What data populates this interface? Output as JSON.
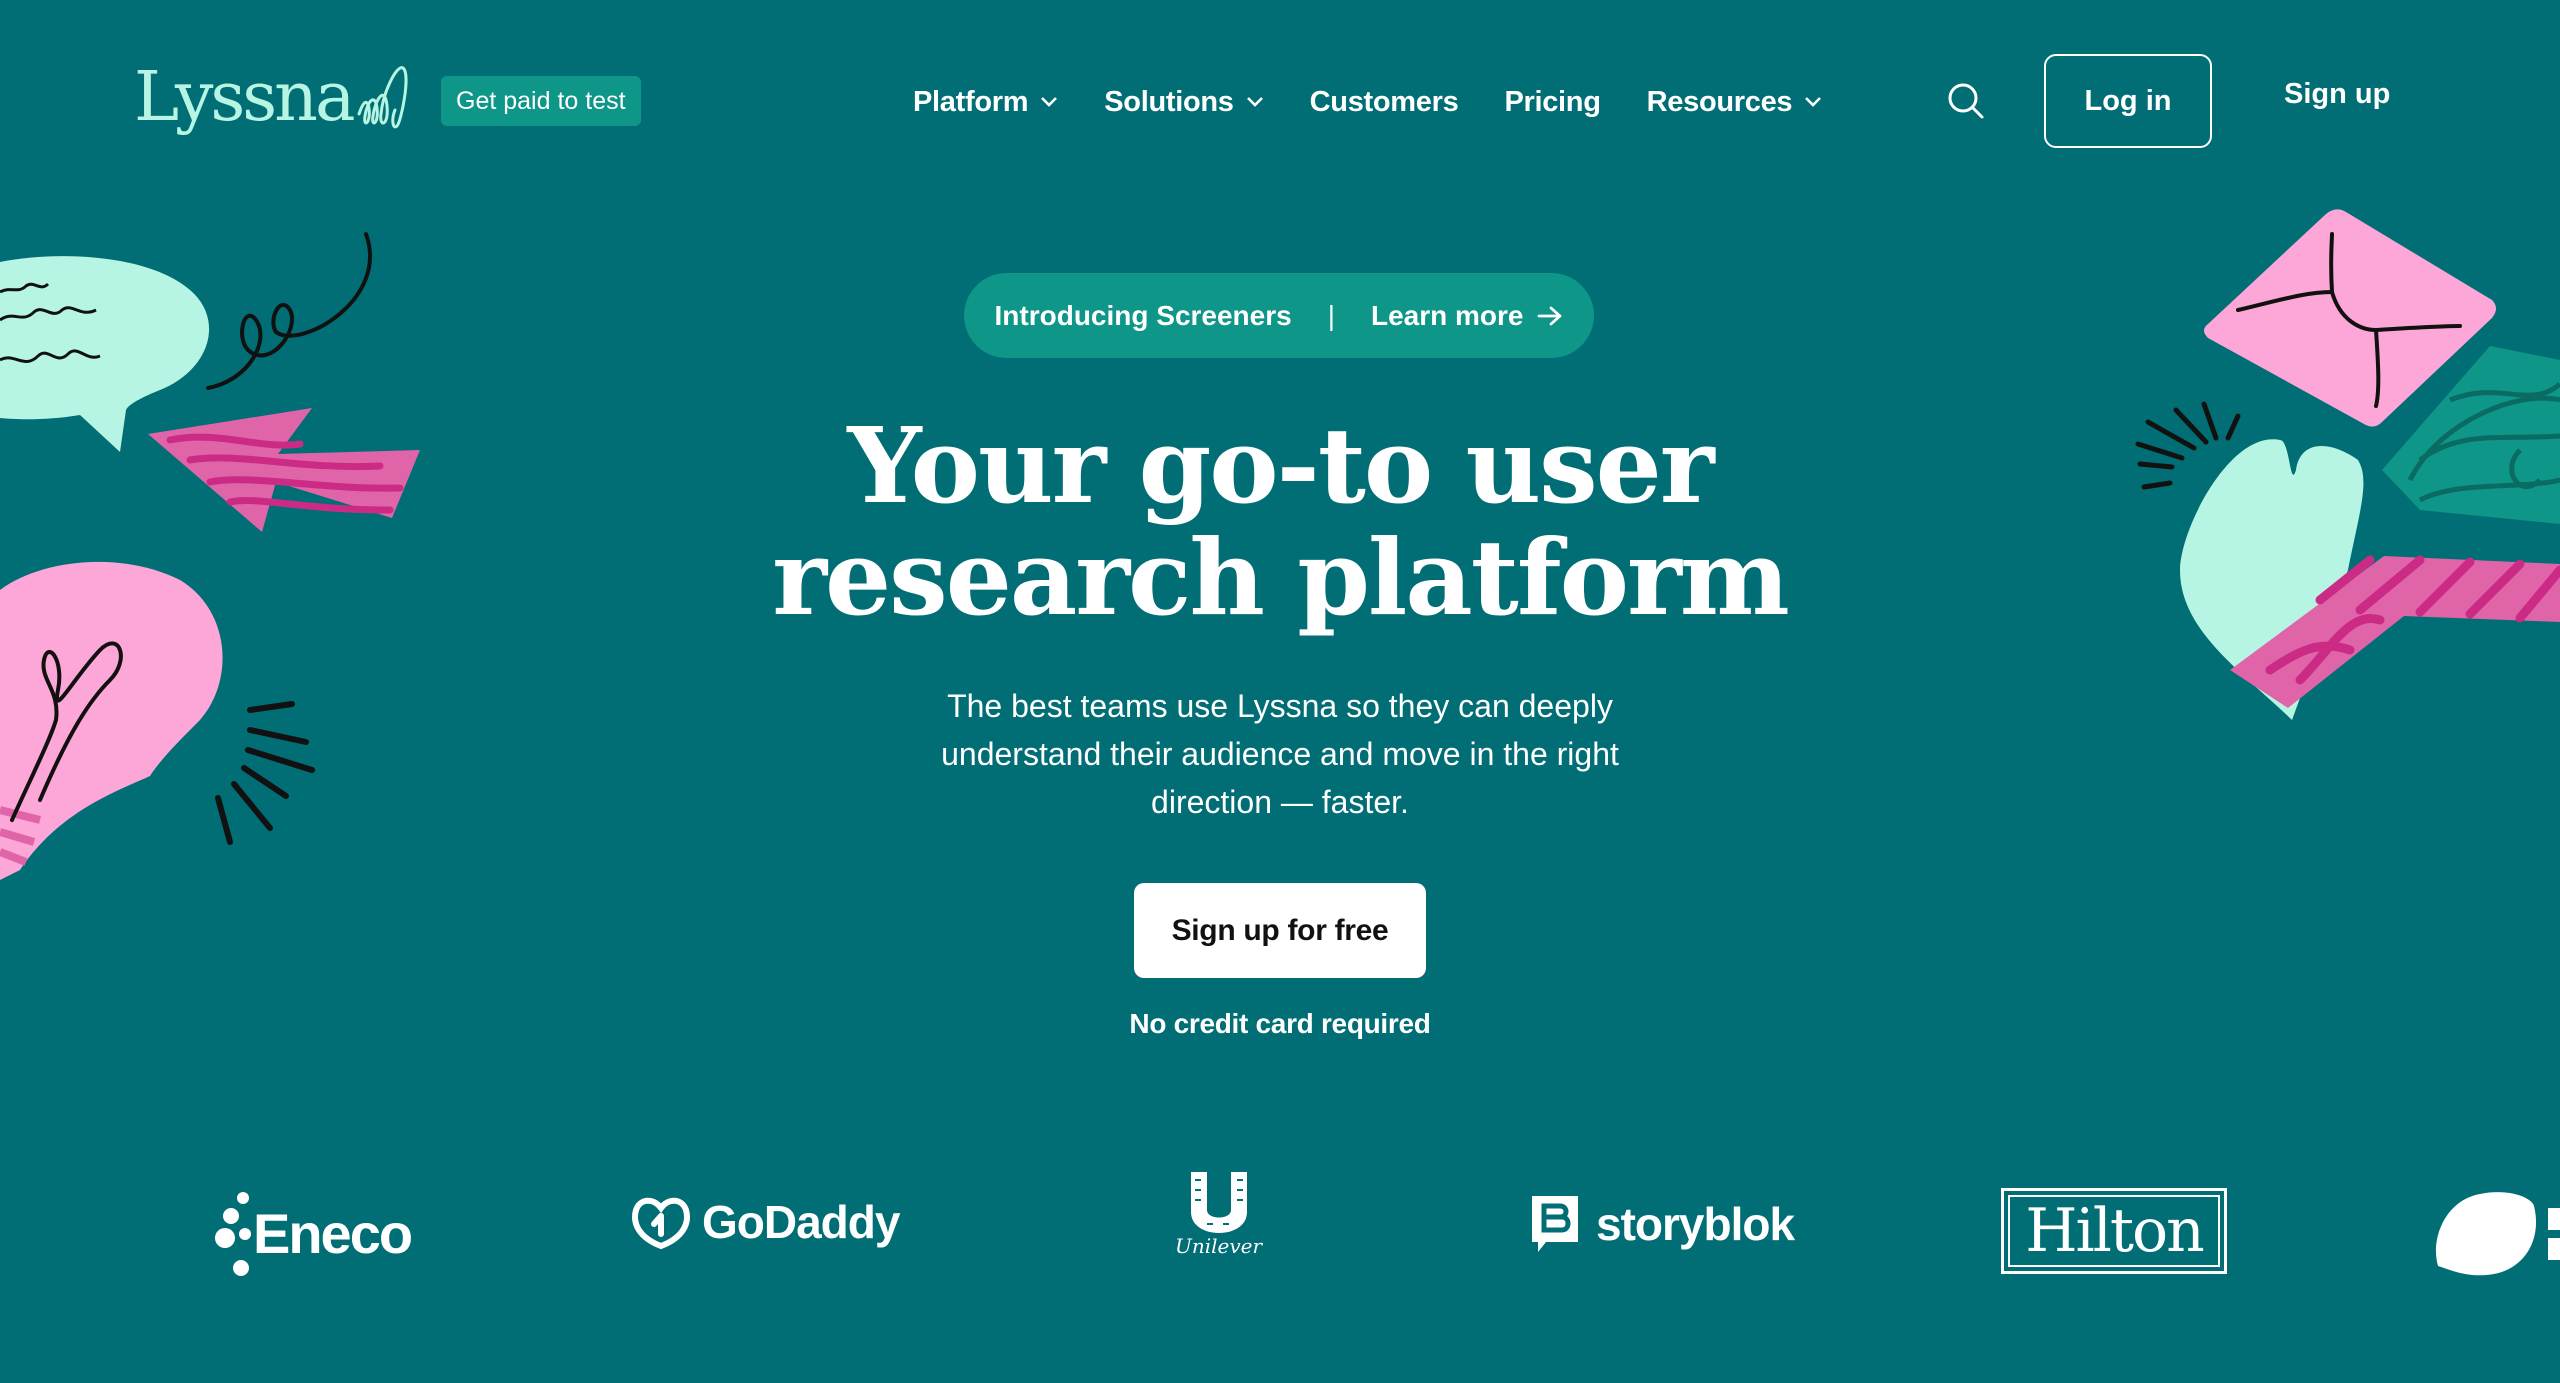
{
  "header": {
    "logo_text": "Lyssna",
    "paid_badge": "Get paid to test",
    "nav": [
      {
        "label": "Platform",
        "has_dropdown": true
      },
      {
        "label": "Solutions",
        "has_dropdown": true
      },
      {
        "label": "Customers",
        "has_dropdown": false
      },
      {
        "label": "Pricing",
        "has_dropdown": false
      },
      {
        "label": "Resources",
        "has_dropdown": true
      }
    ],
    "search_icon": "search-icon",
    "login_label": "Log in",
    "signup_label": "Sign up"
  },
  "hero": {
    "announcement": {
      "text": "Introducing Screeners",
      "separator": "|",
      "link_label": "Learn more",
      "link_icon": "arrow-right-icon"
    },
    "headline_line1": "Your go-to user",
    "headline_line2": "research platform",
    "subtext": "The best teams use Lyssna so they can deeply understand their audience and move in the right direction — faster.",
    "cta_label": "Sign up for free",
    "cta_note": "No credit card required"
  },
  "customer_logos": [
    {
      "name": "Eneco"
    },
    {
      "name": "GoDaddy"
    },
    {
      "name": "Unilever"
    },
    {
      "name": "storyblok"
    },
    {
      "name": "Hilton"
    },
    {
      "name": "lemon-logo-partial"
    }
  ],
  "colors": {
    "background": "#006e74",
    "accent_teal": "#0e9688",
    "mint": "#b6f5e4",
    "pink": "#fda6d8",
    "magenta": "#d42f8a"
  }
}
